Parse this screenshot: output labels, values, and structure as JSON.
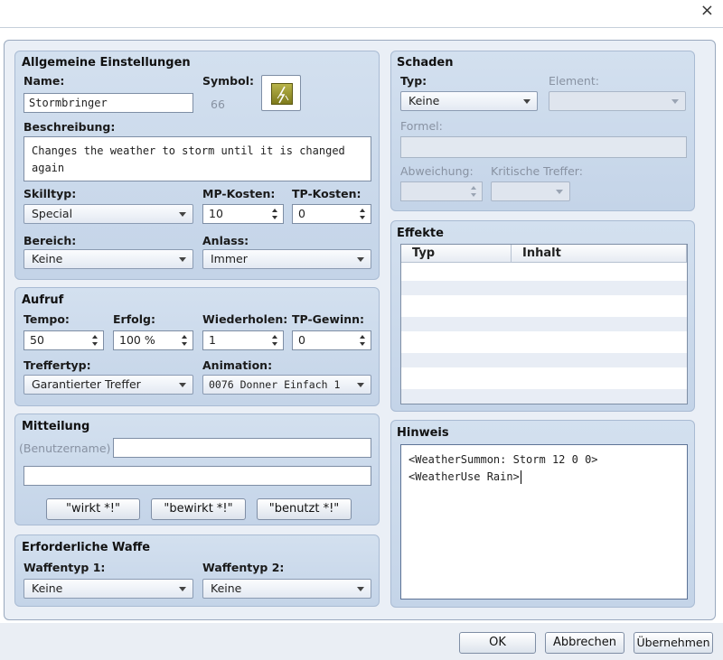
{
  "window": {
    "close_icon": "×"
  },
  "general": {
    "title": "Allgemeine Einstellungen",
    "name_label": "Name:",
    "name_value": "Stormbringer",
    "symbol_label": "Symbol:",
    "symbol_value": "66",
    "desc_label": "Beschreibung:",
    "desc_value": "Changes the weather to storm until it is changed again",
    "skilltype_label": "Skilltyp:",
    "skilltype_value": "Special",
    "mp_label": "MP-Kosten:",
    "mp_value": "10",
    "tp_label": "TP-Kosten:",
    "tp_value": "0",
    "scope_label": "Bereich:",
    "scope_value": "Keine",
    "occasion_label": "Anlass:",
    "occasion_value": "Immer"
  },
  "invocation": {
    "title": "Aufruf",
    "speed_label": "Tempo:",
    "speed_value": "50",
    "success_label": "Erfolg:",
    "success_value": "100 %",
    "repeat_label": "Wiederholen:",
    "repeat_value": "1",
    "tpgain_label": "TP-Gewinn:",
    "tpgain_value": "0",
    "hittype_label": "Treffertyp:",
    "hittype_value": "Garantierter Treffer",
    "animation_label": "Animation:",
    "animation_value": "0076 Donner Einfach 1"
  },
  "message": {
    "title": "Mitteilung",
    "user_label": "(Benutzername)",
    "line1": "",
    "line2": "",
    "btn_wirkt": "\"wirkt *!\"",
    "btn_bewirkt": "\"bewirkt *!\"",
    "btn_benutzt": "\"benutzt *!\""
  },
  "weapon": {
    "title": "Erforderliche Waffe",
    "type1_label": "Waffentyp 1:",
    "type1_value": "Keine",
    "type2_label": "Waffentyp 2:",
    "type2_value": "Keine"
  },
  "damage": {
    "title": "Schaden",
    "type_label": "Typ:",
    "type_value": "Keine",
    "element_label": "Element:",
    "element_value": "",
    "formula_label": "Formel:",
    "formula_value": "",
    "variance_label": "Abweichung:",
    "variance_value": "",
    "critical_label": "Kritische Treffer:",
    "critical_value": ""
  },
  "effects": {
    "title": "Effekte",
    "col_type": "Typ",
    "col_content": "Inhalt"
  },
  "note": {
    "title": "Hinweis",
    "line1": "<WeatherSummon: Storm 12 0 0>",
    "line2": "<WeatherUse Rain>"
  },
  "footer": {
    "ok": "OK",
    "cancel": "Abbrechen",
    "apply": "Übernehmen"
  }
}
